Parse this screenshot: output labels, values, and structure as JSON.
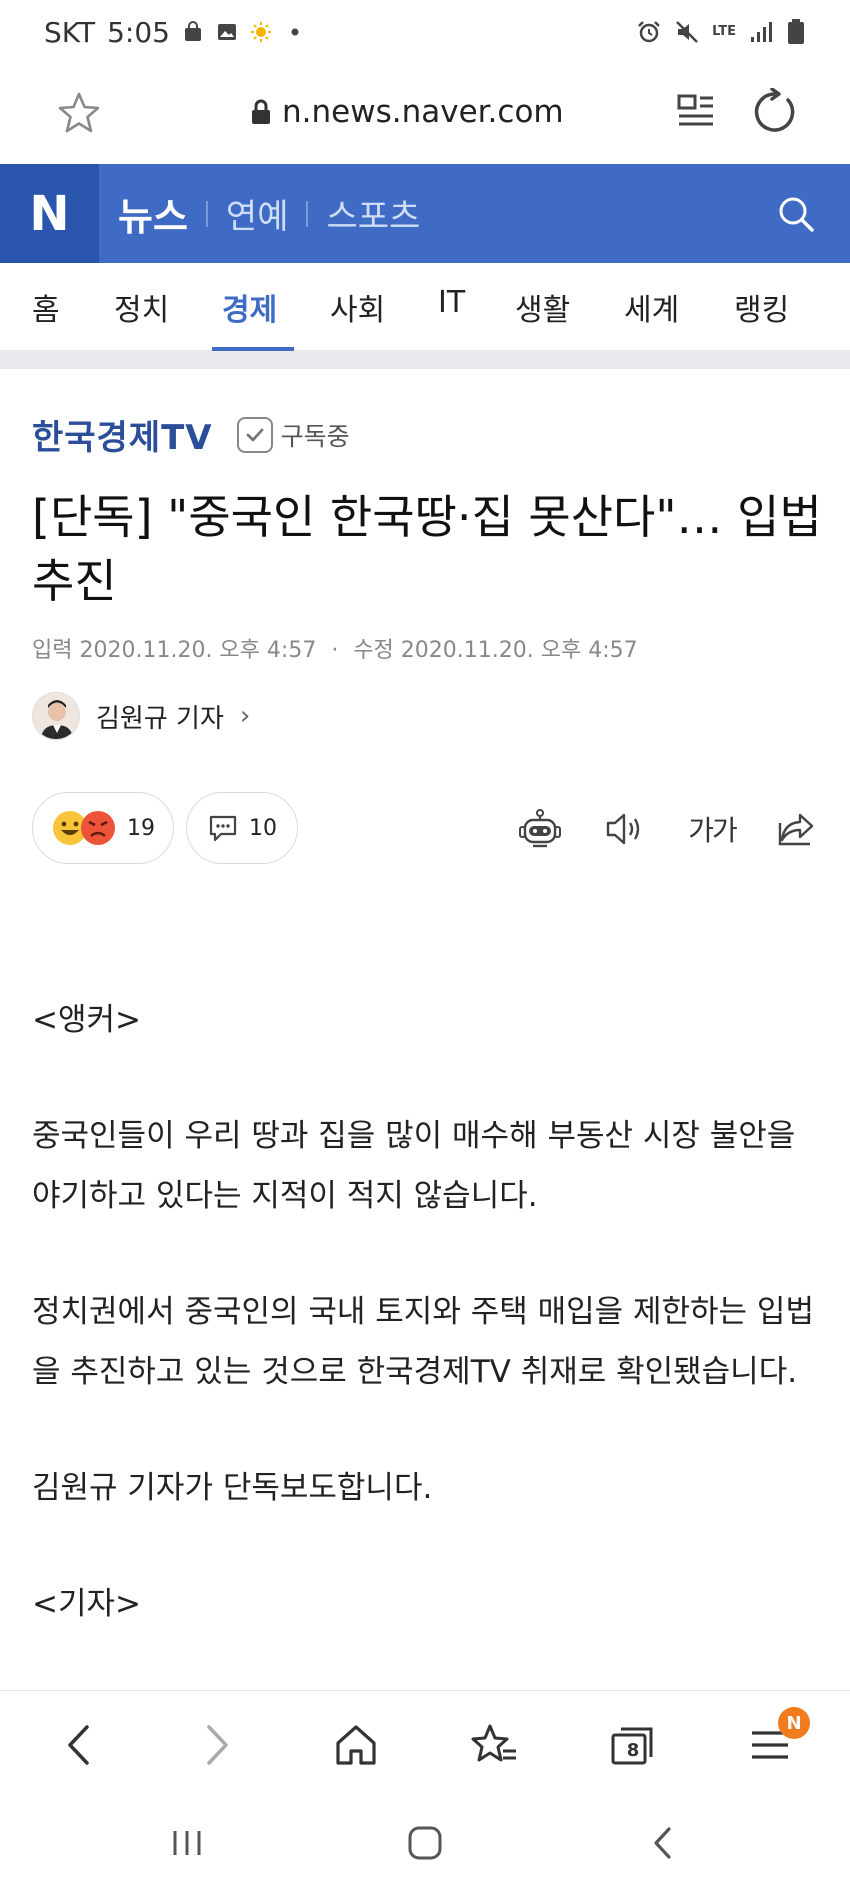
{
  "status_bar": {
    "carrier": "SKT",
    "time": "5:05",
    "network": "LTE"
  },
  "browser": {
    "url": "n.news.naver.com",
    "tab_count": "8",
    "notification_badge": "N"
  },
  "naver_header": {
    "logo": "N",
    "nav": [
      "뉴스",
      "연예",
      "스포츠"
    ]
  },
  "category_tabs": [
    "홈",
    "정치",
    "경제",
    "사회",
    "IT",
    "생활",
    "세계",
    "랭킹"
  ],
  "active_category": "경제",
  "article": {
    "press": "한국경제TV",
    "subscribe_label": "구독중",
    "title": "[단독] \"중국인 한국땅·집 못산다\"… 입법 추진",
    "date_input_label": "입력",
    "date_input": "2020.11.20. 오후 4:57",
    "date_edit_label": "수정",
    "date_edit": "2020.11.20. 오후 4:57",
    "reporter": "김원규 기자",
    "reaction_count": "19",
    "comment_count": "10",
    "font_size_icon": "가가",
    "body": [
      "<앵커>",
      "중국인들이 우리 땅과 집을 많이 매수해 부동산 시장 불안을 야기하고 있다는 지적이 적지 않습니다.",
      "정치권에서 중국인의 국내 토지와 주택 매입을 제한하는 입법을 추진하고 있는 것으로 한국경제TV 취재로 확인됐습니다.",
      "김원규 기자가 단독보도합니다.",
      "<기자>"
    ]
  },
  "colors": {
    "naver_blue": "#3f6bc4",
    "naver_blue_dark": "#2a55ad",
    "press_blue": "#2a4e9a",
    "badge_orange": "#f07c1e"
  }
}
